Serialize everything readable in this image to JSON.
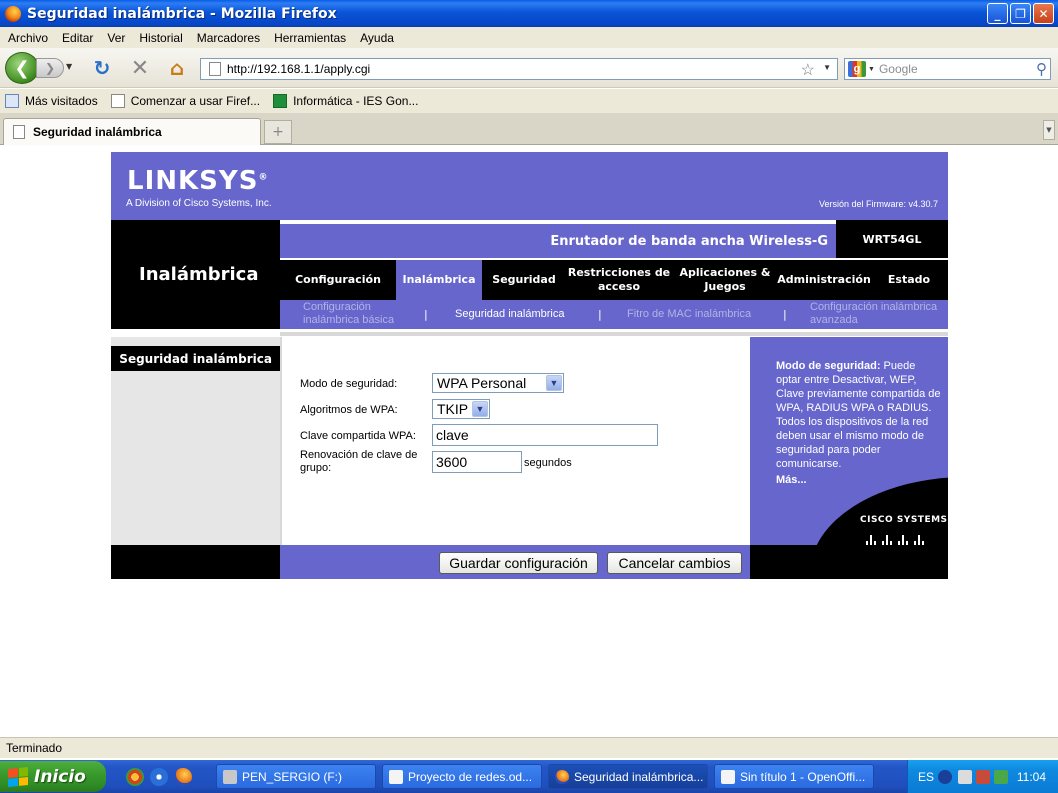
{
  "window": {
    "title": "Seguridad inalámbrica - Mozilla Firefox",
    "minimize_icon": "minimize-icon",
    "maximize_icon": "restore-icon",
    "close_icon": "close-icon"
  },
  "menubar": {
    "items": [
      "Archivo",
      "Editar",
      "Ver",
      "Historial",
      "Marcadores",
      "Herramientas",
      "Ayuda"
    ]
  },
  "navbar": {
    "url": "http://192.168.1.1/apply.cgi",
    "search_placeholder": "Google"
  },
  "bookmarks": {
    "items": [
      "Más visitados",
      "Comenzar a usar Firef...",
      "Informática - IES Gon..."
    ]
  },
  "tabs": {
    "items": [
      {
        "label": "Seguridad inalámbrica"
      }
    ],
    "new_tab_symbol": "+"
  },
  "router": {
    "brand": "LINKSYS",
    "trademark": "®",
    "brand_subtitle": "A Division of Cisco Systems, Inc.",
    "firmware": "Versión del Firmware: v4.30.7",
    "product_name": "Enrutador de banda ancha Wireless-G",
    "model": "WRT54GL",
    "section_title": "Inalámbrica",
    "nav": [
      {
        "label": "Configuración",
        "active": false
      },
      {
        "label": "Inalámbrica",
        "active": true
      },
      {
        "label": "Seguridad",
        "active": false
      },
      {
        "label": "Restricciones de acceso",
        "active": false
      },
      {
        "label": "Aplicaciones & Juegos",
        "active": false
      },
      {
        "label": "Administración",
        "active": false
      },
      {
        "label": "Estado",
        "active": false
      }
    ],
    "subnav": [
      {
        "label": "Configuración inalámbrica básica",
        "active": false
      },
      {
        "label": "Seguridad inalámbrica",
        "active": true
      },
      {
        "label": "Fitro de MAC  inalámbrica",
        "active": false
      },
      {
        "label": "Configuración inalámbrica avanzada",
        "active": false
      }
    ],
    "subnav_separator": "|",
    "left_heading": "Seguridad inalámbrica",
    "form": {
      "security_mode_label": "Modo de seguridad:",
      "security_mode_value": "WPA Personal",
      "wpa_algorithm_label": "Algoritmos de WPA:",
      "wpa_algorithm_value": "TKIP",
      "shared_key_label": "Clave compartida  WPA:",
      "shared_key_value": "clave",
      "group_key_label": "Renovación de clave de grupo:",
      "group_key_value": "3600",
      "group_key_unit": "segundos"
    },
    "help": {
      "title": "Modo de seguridad:",
      "body": " Puede optar entre Desactivar, WEP, Clave previamente compartida de WPA, RADIUS WPA o RADIUS. Todos los dispositivos de la red deben usar el mismo modo de seguridad para poder comunicarse.",
      "more": "Más..."
    },
    "cisco_logo": "CISCO SYSTEMS",
    "buttons": {
      "save": "Guardar configuración",
      "cancel": "Cancelar cambios"
    }
  },
  "statusbar": {
    "text": "Terminado"
  },
  "taskbar": {
    "start_label": "Inicio",
    "tasks": [
      {
        "label": "PEN_SERGIO (F:)",
        "active": false
      },
      {
        "label": "Proyecto de redes.od...",
        "active": false
      },
      {
        "label": "Seguridad inalámbrica...",
        "active": true
      },
      {
        "label": "Sin título 1 - OpenOffi...",
        "active": false
      }
    ],
    "language": "ES",
    "clock": "11:04"
  }
}
